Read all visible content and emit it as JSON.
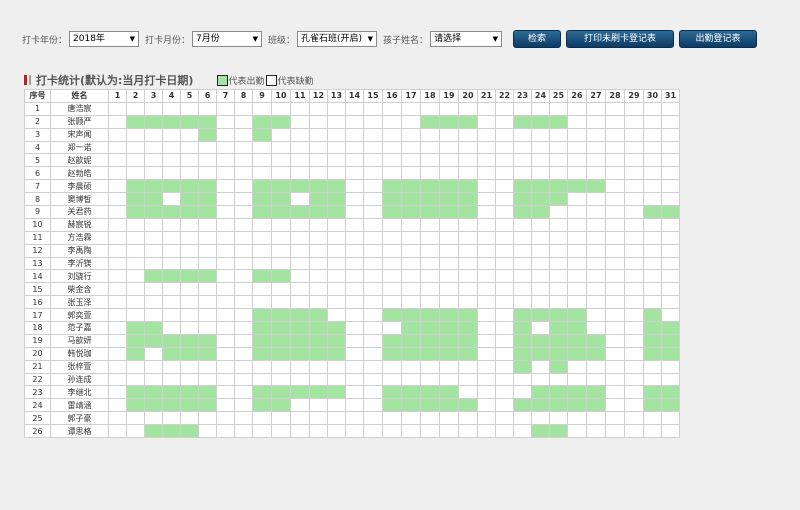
{
  "filters": {
    "year_label": "打卡年份：",
    "year_value": "2018年",
    "month_label": "打卡月份：",
    "month_value": "7月份",
    "class_label": "班级：",
    "class_value": "孔雀石班(开启)",
    "child_label": "孩子姓名：",
    "child_value": "请选择"
  },
  "buttons": {
    "search": "检索",
    "print_unswiped": "打印未刷卡登记表",
    "attendance_register": "出勤登记表"
  },
  "stats": {
    "title": "打卡统计(默认为:当月打卡日期)",
    "legend_present": "代表出勤",
    "legend_absent": "代表缺勤"
  },
  "colors": {
    "present": "#a3e4a0",
    "title_bar_red": "#b3261e",
    "title_bar_gray": "#9e9e9e",
    "button": "#134a76"
  },
  "table": {
    "headers": [
      "序号",
      "姓名",
      "1",
      "2",
      "3",
      "4",
      "5",
      "6",
      "7",
      "8",
      "9",
      "10",
      "11",
      "12",
      "13",
      "14",
      "15",
      "16",
      "17",
      "18",
      "19",
      "20",
      "21",
      "22",
      "23",
      "24",
      "25",
      "26",
      "27",
      "28",
      "29",
      "30",
      "31"
    ],
    "rows": [
      {
        "no": "1",
        "name": "唐浩宸",
        "present": []
      },
      {
        "no": "2",
        "name": "张颢严",
        "present": [
          2,
          3,
          4,
          5,
          6,
          9,
          10,
          18,
          19,
          20,
          23,
          24,
          25
        ]
      },
      {
        "no": "3",
        "name": "宋声闻",
        "present": [
          6,
          9
        ]
      },
      {
        "no": "4",
        "name": "郑一诺",
        "present": []
      },
      {
        "no": "5",
        "name": "赵歆妮",
        "present": []
      },
      {
        "no": "6",
        "name": "赵勃皓",
        "present": []
      },
      {
        "no": "7",
        "name": "李晨硕",
        "present": [
          2,
          3,
          4,
          5,
          6,
          9,
          10,
          11,
          12,
          13,
          16,
          17,
          18,
          19,
          20,
          23,
          24,
          25,
          26,
          27
        ]
      },
      {
        "no": "8",
        "name": "窦博皙",
        "present": [
          2,
          3,
          5,
          6,
          9,
          10,
          12,
          13,
          16,
          17,
          18,
          19,
          20,
          23,
          24,
          25
        ]
      },
      {
        "no": "9",
        "name": "关君药",
        "present": [
          2,
          3,
          4,
          5,
          6,
          9,
          10,
          11,
          12,
          13,
          16,
          17,
          18,
          19,
          20,
          23,
          24,
          30,
          31
        ]
      },
      {
        "no": "10",
        "name": "赫宸锐",
        "present": []
      },
      {
        "no": "11",
        "name": "方浩霖",
        "present": []
      },
      {
        "no": "12",
        "name": "李禹陶",
        "present": []
      },
      {
        "no": "13",
        "name": "李沂镁",
        "present": []
      },
      {
        "no": "14",
        "name": "刘骁行",
        "present": [
          3,
          4,
          5,
          6,
          9,
          10
        ]
      },
      {
        "no": "15",
        "name": "柴金含",
        "present": []
      },
      {
        "no": "16",
        "name": "张玉泽",
        "present": []
      },
      {
        "no": "17",
        "name": "郭奕萱",
        "present": [
          9,
          10,
          11,
          12,
          16,
          17,
          18,
          19,
          20,
          23,
          24,
          25,
          26,
          30
        ]
      },
      {
        "no": "18",
        "name": "范子嘉",
        "present": [
          2,
          3,
          9,
          10,
          11,
          12,
          13,
          17,
          18,
          19,
          20,
          23,
          25,
          26,
          30,
          31
        ]
      },
      {
        "no": "19",
        "name": "马歆妍",
        "present": [
          2,
          3,
          4,
          5,
          6,
          9,
          10,
          11,
          12,
          13,
          16,
          17,
          18,
          19,
          20,
          23,
          24,
          25,
          26,
          27,
          30,
          31
        ]
      },
      {
        "no": "20",
        "name": "韩悦珈",
        "present": [
          2,
          4,
          5,
          6,
          9,
          10,
          11,
          12,
          13,
          16,
          17,
          18,
          19,
          20,
          23,
          24,
          25,
          26,
          27,
          30,
          31
        ]
      },
      {
        "no": "21",
        "name": "张梓萱",
        "present": [
          23,
          25
        ]
      },
      {
        "no": "22",
        "name": "孙连成",
        "present": []
      },
      {
        "no": "23",
        "name": "李继北",
        "present": [
          2,
          3,
          4,
          5,
          6,
          9,
          10,
          11,
          12,
          13,
          16,
          17,
          18,
          19,
          24,
          25,
          26,
          27,
          30,
          31
        ]
      },
      {
        "no": "24",
        "name": "雷靖涵",
        "present": [
          2,
          3,
          4,
          5,
          6,
          9,
          10,
          16,
          17,
          18,
          19,
          20,
          23,
          24,
          25,
          26,
          27,
          30,
          31
        ]
      },
      {
        "no": "25",
        "name": "郭子豪",
        "present": []
      },
      {
        "no": "26",
        "name": "谭思格",
        "present": [
          3,
          4,
          5,
          24,
          25
        ]
      }
    ]
  }
}
